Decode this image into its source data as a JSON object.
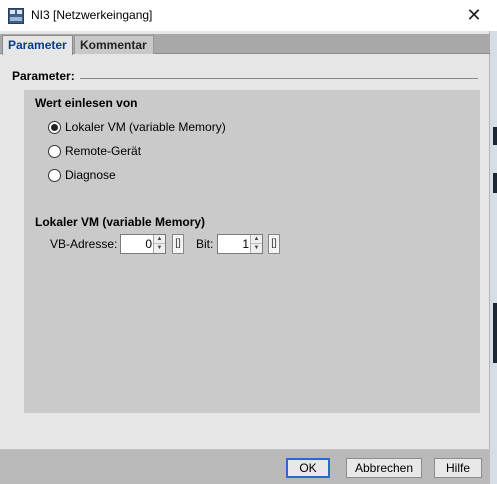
{
  "window": {
    "title": "NI3 [Netzwerkeingang]",
    "close_glyph": "✕",
    "icon": "logo-app-icon"
  },
  "tabs": [
    {
      "label": "Parameter",
      "active": true
    },
    {
      "label": "Kommentar",
      "active": false
    }
  ],
  "section": {
    "title": "Parameter:"
  },
  "read_group": {
    "title": "Wert einlesen von",
    "options": [
      {
        "label": "Lokaler VM (variable Memory)",
        "checked": true
      },
      {
        "label": "Remote-Gerät",
        "checked": false
      },
      {
        "label": "Diagnose",
        "checked": false
      }
    ]
  },
  "local_group": {
    "title": "Lokaler VM (variable Memory)",
    "vb_label": "VB-Adresse:",
    "vb_value": "0",
    "bit_label": "Bit:",
    "bit_value": "1",
    "bracket_glyph": "[]"
  },
  "buttons": {
    "ok": "OK",
    "cancel": "Abbrechen",
    "help": "Hilfe"
  },
  "colors": {
    "accent": "#0a3a8a",
    "focus_border": "#2a6ad0",
    "panel": "#cacaca",
    "background": "#e6e6e6"
  }
}
